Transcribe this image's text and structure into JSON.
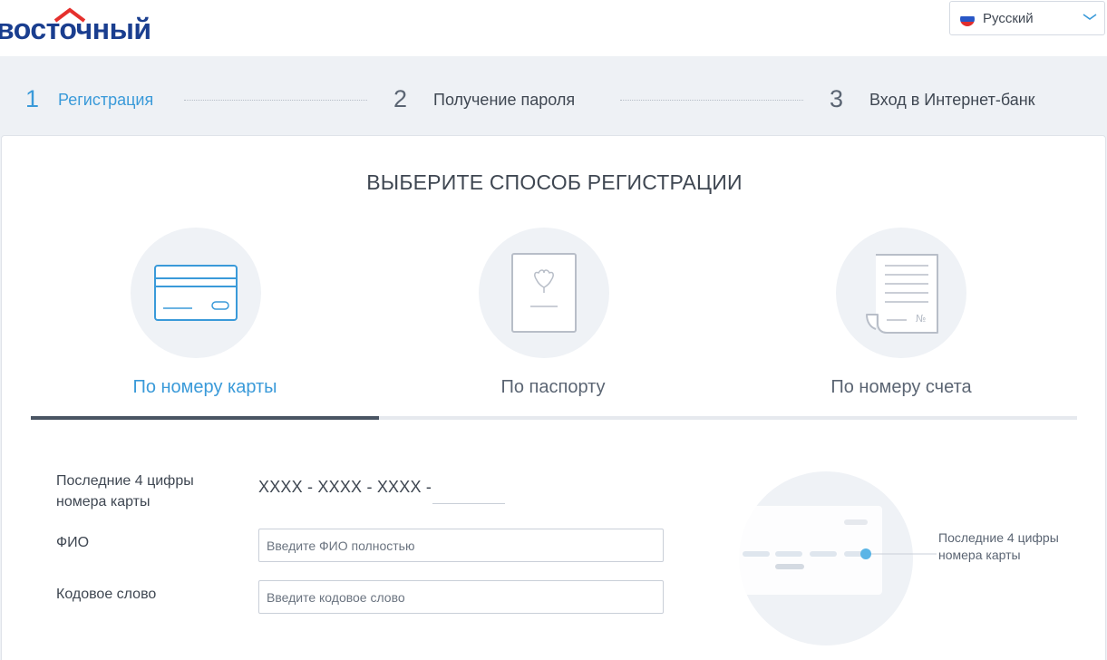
{
  "brand": {
    "name": "восточный",
    "logo_color": "#1a3e8f",
    "roof_color": "#e5302d"
  },
  "language": {
    "selected": "Русский",
    "flag_icon": "russia-flag-icon"
  },
  "steps": [
    {
      "number": "1",
      "label": "Регистрация",
      "active": true
    },
    {
      "number": "2",
      "label": "Получение пароля",
      "active": false
    },
    {
      "number": "3",
      "label": "Вход в Интернет-банк",
      "active": false
    }
  ],
  "main": {
    "title": "ВЫБЕРИТЕ СПОСОБ РЕГИСТРАЦИИ",
    "methods": [
      {
        "label": "По номеру карты",
        "icon": "credit-card-icon",
        "active": true
      },
      {
        "label": "По паспорту",
        "icon": "passport-icon",
        "active": false
      },
      {
        "label": "По номеру счета",
        "icon": "account-statement-icon",
        "active": false
      }
    ]
  },
  "form": {
    "card_digits_label": "Последние 4 цифры номера карты",
    "card_mask": "XXXX - XXXX - XXXX -",
    "card_digits_value": "",
    "fio_label": "ФИО",
    "fio_placeholder": "Введите ФИО полностью",
    "codeword_label": "Кодовое слово",
    "codeword_placeholder": "Введите кодовое слово"
  },
  "hint": {
    "text": "Последние 4 цифры номера карты"
  },
  "colors": {
    "accent": "#3a9ad9",
    "text": "#3f4752",
    "tab_active": "#4a5563"
  }
}
